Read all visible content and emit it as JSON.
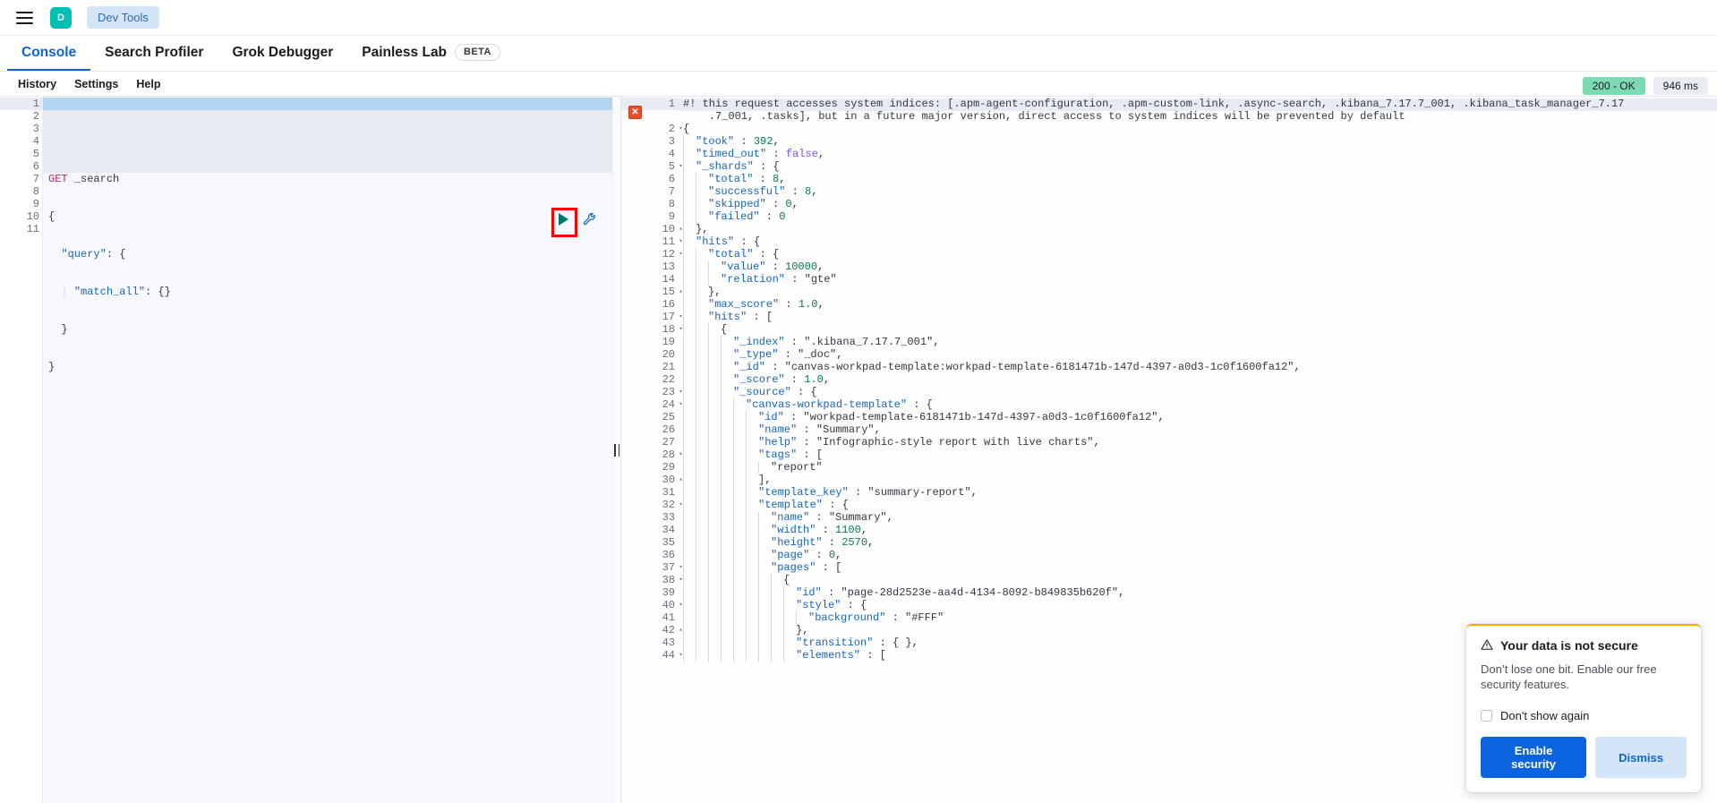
{
  "topbar": {
    "menu_icon": "hamburger-icon",
    "avatar_letter": "D",
    "breadcrumb": "Dev Tools"
  },
  "tabs": [
    {
      "label": "Console",
      "active": true
    },
    {
      "label": "Search Profiler",
      "active": false
    },
    {
      "label": "Grok Debugger",
      "active": false
    },
    {
      "label": "Painless Lab",
      "active": false,
      "badge": "BETA"
    }
  ],
  "subnav": [
    {
      "label": "History"
    },
    {
      "label": "Settings"
    },
    {
      "label": "Help"
    }
  ],
  "request_editor": {
    "gutter": [
      {
        "num": "1",
        "fold": ""
      },
      {
        "num": "2",
        "fold": "▾"
      },
      {
        "num": "3",
        "fold": "▾"
      },
      {
        "num": "4",
        "fold": ""
      },
      {
        "num": "5",
        "fold": "▴"
      },
      {
        "num": "6",
        "fold": "▴"
      },
      {
        "num": "7",
        "fold": ""
      },
      {
        "num": "8",
        "fold": ""
      },
      {
        "num": "9",
        "fold": ""
      },
      {
        "num": "10",
        "fold": ""
      },
      {
        "num": "11",
        "fold": ""
      }
    ],
    "method": "GET",
    "path": "_search",
    "lines": [
      "{",
      "  \"query\": {",
      "    \"match_all\": {}",
      "  }",
      "}"
    ],
    "run_icon": "play-icon",
    "wrench_icon": "wrench-icon"
  },
  "response": {
    "status_label": "200 - OK",
    "time_label": "946 ms",
    "status_color": "#7ddbb4",
    "error_marker_icon": "error-x-icon",
    "warning_line_1": "#! this request accesses system indices: [.apm-agent-configuration, .apm-custom-link, .async-search, .kibana_7.17.7_001, .kibana_task_manager_7.17",
    "warning_line_2": ".7_001, .tasks], but in a future major version, direct access to system indices will be prevented by default",
    "lines": [
      {
        "num": "2",
        "fold": "▾",
        "indent": 0,
        "text": "{"
      },
      {
        "num": "3",
        "fold": "",
        "indent": 1,
        "text": "\"took\" : 392,"
      },
      {
        "num": "4",
        "fold": "",
        "indent": 1,
        "text": "\"timed_out\" : false,"
      },
      {
        "num": "5",
        "fold": "▾",
        "indent": 1,
        "text": "\"_shards\" : {"
      },
      {
        "num": "6",
        "fold": "",
        "indent": 2,
        "text": "\"total\" : 8,"
      },
      {
        "num": "7",
        "fold": "",
        "indent": 2,
        "text": "\"successful\" : 8,"
      },
      {
        "num": "8",
        "fold": "",
        "indent": 2,
        "text": "\"skipped\" : 0,"
      },
      {
        "num": "9",
        "fold": "",
        "indent": 2,
        "text": "\"failed\" : 0"
      },
      {
        "num": "10",
        "fold": "▴",
        "indent": 1,
        "text": "},"
      },
      {
        "num": "11",
        "fold": "▾",
        "indent": 1,
        "text": "\"hits\" : {"
      },
      {
        "num": "12",
        "fold": "▾",
        "indent": 2,
        "text": "\"total\" : {"
      },
      {
        "num": "13",
        "fold": "",
        "indent": 3,
        "text": "\"value\" : 10000,"
      },
      {
        "num": "14",
        "fold": "",
        "indent": 3,
        "text": "\"relation\" : \"gte\""
      },
      {
        "num": "15",
        "fold": "▴",
        "indent": 2,
        "text": "},"
      },
      {
        "num": "16",
        "fold": "",
        "indent": 2,
        "text": "\"max_score\" : 1.0,"
      },
      {
        "num": "17",
        "fold": "▾",
        "indent": 2,
        "text": "\"hits\" : ["
      },
      {
        "num": "18",
        "fold": "▾",
        "indent": 3,
        "text": "{"
      },
      {
        "num": "19",
        "fold": "",
        "indent": 4,
        "text": "\"_index\" : \".kibana_7.17.7_001\","
      },
      {
        "num": "20",
        "fold": "",
        "indent": 4,
        "text": "\"_type\" : \"_doc\","
      },
      {
        "num": "21",
        "fold": "",
        "indent": 4,
        "text": "\"_id\" : \"canvas-workpad-template:workpad-template-6181471b-147d-4397-a0d3-1c0f1600fa12\","
      },
      {
        "num": "22",
        "fold": "",
        "indent": 4,
        "text": "\"_score\" : 1.0,"
      },
      {
        "num": "23",
        "fold": "▾",
        "indent": 4,
        "text": "\"_source\" : {"
      },
      {
        "num": "24",
        "fold": "▾",
        "indent": 5,
        "text": "\"canvas-workpad-template\" : {"
      },
      {
        "num": "25",
        "fold": "",
        "indent": 6,
        "text": "\"id\" : \"workpad-template-6181471b-147d-4397-a0d3-1c0f1600fa12\","
      },
      {
        "num": "26",
        "fold": "",
        "indent": 6,
        "text": "\"name\" : \"Summary\","
      },
      {
        "num": "27",
        "fold": "",
        "indent": 6,
        "text": "\"help\" : \"Infographic-style report with live charts\","
      },
      {
        "num": "28",
        "fold": "▾",
        "indent": 6,
        "text": "\"tags\" : ["
      },
      {
        "num": "29",
        "fold": "",
        "indent": 7,
        "text": "\"report\""
      },
      {
        "num": "30",
        "fold": "▴",
        "indent": 6,
        "text": "],"
      },
      {
        "num": "31",
        "fold": "",
        "indent": 6,
        "text": "\"template_key\" : \"summary-report\","
      },
      {
        "num": "32",
        "fold": "▾",
        "indent": 6,
        "text": "\"template\" : {"
      },
      {
        "num": "33",
        "fold": "",
        "indent": 7,
        "text": "\"name\" : \"Summary\","
      },
      {
        "num": "34",
        "fold": "",
        "indent": 7,
        "text": "\"width\" : 1100,"
      },
      {
        "num": "35",
        "fold": "",
        "indent": 7,
        "text": "\"height\" : 2570,"
      },
      {
        "num": "36",
        "fold": "",
        "indent": 7,
        "text": "\"page\" : 0,"
      },
      {
        "num": "37",
        "fold": "▾",
        "indent": 7,
        "text": "\"pages\" : ["
      },
      {
        "num": "38",
        "fold": "▾",
        "indent": 8,
        "text": "{"
      },
      {
        "num": "39",
        "fold": "",
        "indent": 9,
        "text": "\"id\" : \"page-28d2523e-aa4d-4134-8092-b849835b620f\","
      },
      {
        "num": "40",
        "fold": "▾",
        "indent": 9,
        "text": "\"style\" : {"
      },
      {
        "num": "41",
        "fold": "",
        "indent": 10,
        "text": "\"background\" : \"#FFF\""
      },
      {
        "num": "42",
        "fold": "▴",
        "indent": 9,
        "text": "},"
      },
      {
        "num": "43",
        "fold": "",
        "indent": 9,
        "text": "\"transition\" : { },"
      },
      {
        "num": "44",
        "fold": "▾",
        "indent": 9,
        "text": "\"elements\" : ["
      }
    ]
  },
  "toast": {
    "icon": "warning-triangle-icon",
    "title": "Your data is not secure",
    "body": "Don’t lose one bit. Enable our free security features.",
    "checkbox_label": "Don't show again",
    "checkbox_checked": false,
    "primary_button": "Enable security",
    "secondary_button": "Dismiss"
  },
  "colors": {
    "accent": "#0b64dd",
    "brand_avatar": "#00bfb3",
    "status_ok": "#7ddbb4",
    "toast_border": "#f5a700",
    "highlight_box": "#ff0000"
  }
}
